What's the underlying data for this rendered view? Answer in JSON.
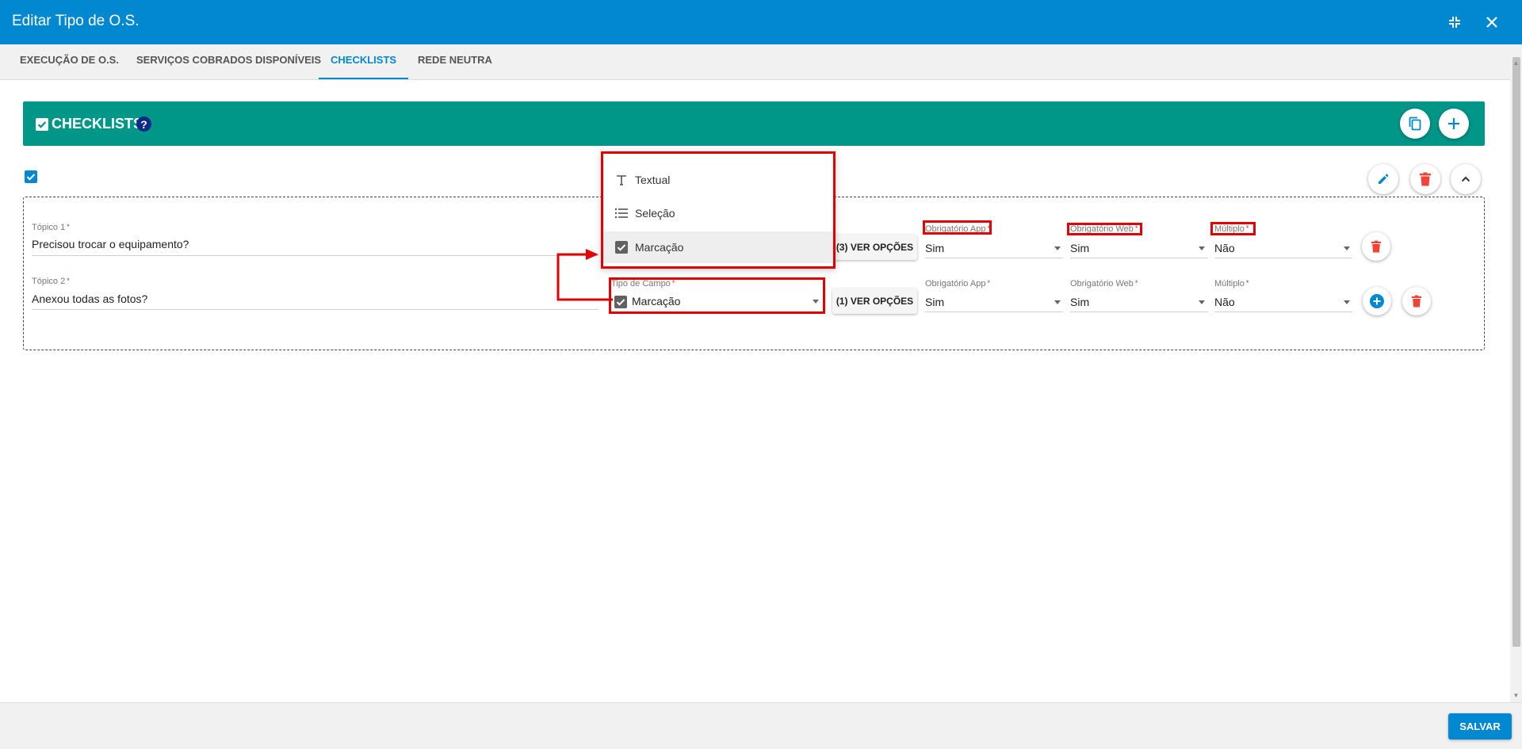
{
  "window": {
    "title": "Editar Tipo de O.S."
  },
  "tabs": [
    {
      "label": "EXECUÇÃO DE O.S."
    },
    {
      "label": "SERVIÇOS COBRADOS DISPONÍVEIS"
    },
    {
      "label": "CHECKLISTS"
    },
    {
      "label": "REDE NEUTRA"
    }
  ],
  "active_tab": "CHECKLISTS",
  "checklists_header": {
    "title": "CHECKLISTS",
    "help": "?"
  },
  "rows": [
    {
      "topic_label": "Tópico 1",
      "topic_value": "Precisou trocar o equipamento?",
      "ver_opcoes": "(3) VER OPÇÕES",
      "obrig_app_label": "Obrigatório App",
      "obrig_app_value": "Sim",
      "obrig_web_label": "Obrigatório Web",
      "obrig_web_value": "Sim",
      "multiplo_label": "Múltiplo",
      "multiplo_value": "Não"
    },
    {
      "topic_label": "Tópico 2",
      "topic_value": "Anexou todas as fotos?",
      "tipo_label": "Tipo de Campo",
      "tipo_value": "Marcação",
      "ver_opcoes": "(1) VER OPÇÕES",
      "obrig_app_label": "Obrigatório App",
      "obrig_app_value": "Sim",
      "obrig_web_label": "Obrigatório Web",
      "obrig_web_value": "Sim",
      "multiplo_label": "Múltiplo",
      "multiplo_value": "Não"
    }
  ],
  "dropdown_options": [
    {
      "label": "Textual",
      "icon": "text-icon"
    },
    {
      "label": "Seleção",
      "icon": "list-icon"
    },
    {
      "label": "Marcação",
      "icon": "checkbox-icon",
      "selected": true
    }
  ],
  "required_mark": "*",
  "footer": {
    "save_label": "SALVAR"
  },
  "colors": {
    "primary": "#0288d1",
    "header_teal": "#009688",
    "danger": "#f44336",
    "annotation": "#e50000"
  }
}
